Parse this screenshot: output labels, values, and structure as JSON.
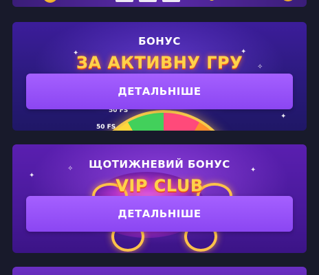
{
  "cards": [
    {
      "subtitle": "БОНУС",
      "headline": "ЗА АКТИВНУ ГРУ",
      "button_label": "ДЕТАЛЬНІШЕ",
      "wheel_labels": [
        "50 FS",
        "50 FS"
      ]
    },
    {
      "subtitle": "ЩОТИЖНЕВИЙ БОНУС",
      "headline": "VIP CLUB",
      "button_label": "ДЕТАЛЬНІШЕ"
    }
  ],
  "colors": {
    "page_bg": "#181a2b",
    "button": "#9a52fb",
    "headline": "#ffd24a"
  },
  "icons": [
    "coin-icon",
    "slot-machine-icon",
    "sparkle-icon",
    "fortune-wheel-icon",
    "vip-emblem-icon"
  ]
}
